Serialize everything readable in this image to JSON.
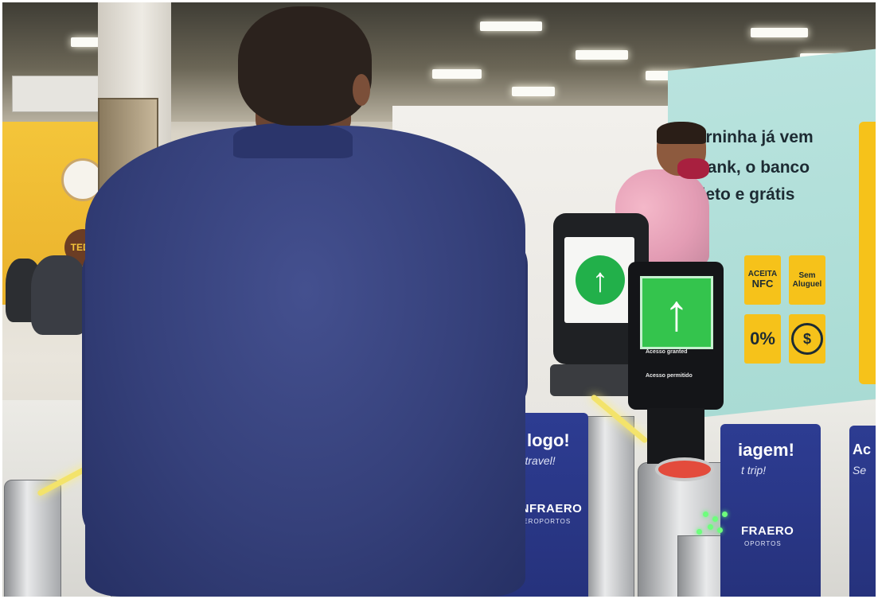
{
  "scene": {
    "description_colors": {
      "shirt": "#35407a",
      "ad_background": "#b9e3de",
      "ad_accent_yellow": "#f6c21a",
      "banner_blue": "#2d3c92",
      "arrow_green": "#34c44d"
    }
  },
  "left_kiosk": {
    "tag": "TEDs"
  },
  "ad_panel": {
    "line1": "oderninha já vem",
    "line2": "agBank, o banco",
    "line3": "mpleto e grátis",
    "box1_top": "ACEITA",
    "box1_bottom": "NFC",
    "box2_top": "Sem",
    "box2_bottom": "Aluguel",
    "box3": "0%",
    "box4": "$"
  },
  "devices": {
    "bio_line1": "Acesso granted",
    "bio_line2": "Acesso permitido"
  },
  "banners": {
    "center_big": "AME logo!",
    "center_small": "Let's go travel!",
    "center_brand": "INFRAERO",
    "center_sub": "AEROPORTOS",
    "right_big": "iagem!",
    "right_small": "t trip!",
    "right_brand": "FRAERO",
    "right_sub": "OPORTOS",
    "far_right_big": "Ac",
    "far_right_small": "Se"
  }
}
